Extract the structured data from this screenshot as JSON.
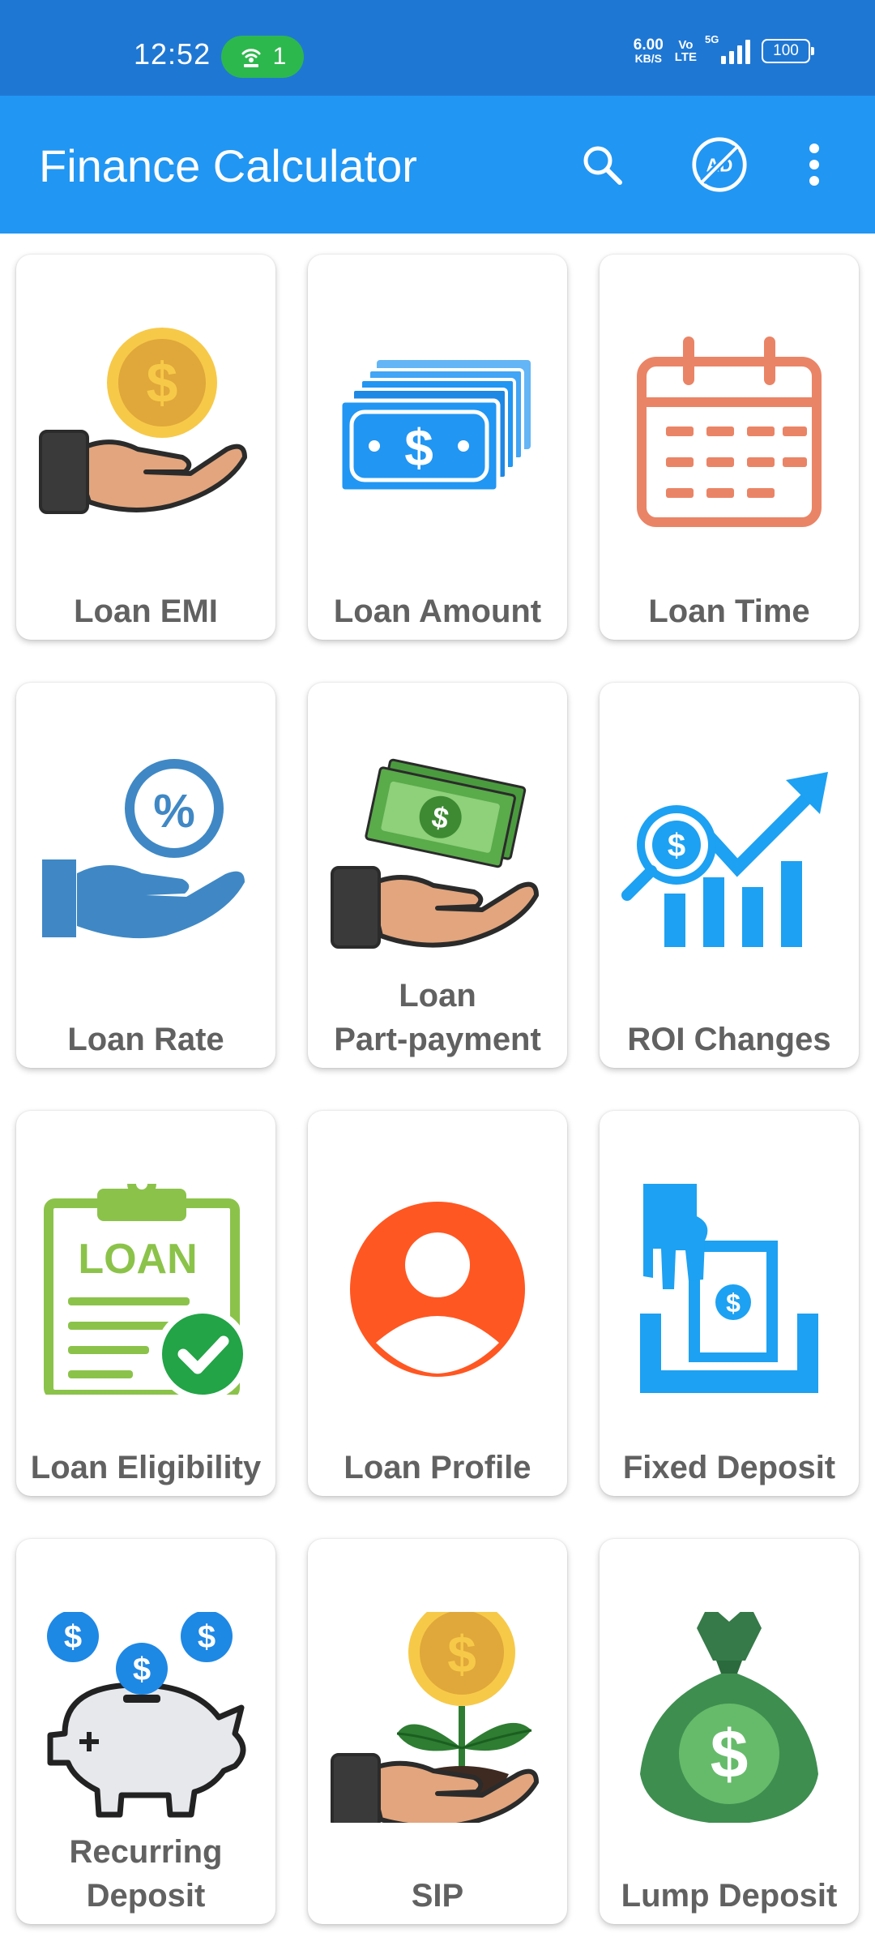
{
  "status_bar": {
    "time": "12:52",
    "hotspot_count": "1",
    "net_speed_value": "6.00",
    "net_speed_unit": "KB/S",
    "volte_top": "Vo",
    "volte_bottom": "LTE",
    "network_type": "5G",
    "battery": "100"
  },
  "app_bar": {
    "title": "Finance Calculator",
    "icons": [
      "search-icon",
      "ad-off-icon",
      "more-vert-icon"
    ]
  },
  "tiles": [
    {
      "label": "Loan EMI",
      "icon": "hand-coin-icon"
    },
    {
      "label": "Loan Amount",
      "icon": "cash-stack-icon"
    },
    {
      "label": "Loan Time",
      "icon": "calendar-icon"
    },
    {
      "label": "Loan Rate",
      "icon": "hand-percent-icon"
    },
    {
      "label": "Loan\nPart-payment",
      "icon": "hand-cash-icon"
    },
    {
      "label": "ROI Changes",
      "icon": "growth-chart-icon"
    },
    {
      "label": "Loan Eligibility",
      "icon": "loan-clipboard-icon"
    },
    {
      "label": "Loan Profile",
      "icon": "user-avatar-icon"
    },
    {
      "label": "Fixed Deposit",
      "icon": "cash-deposit-icon"
    },
    {
      "label": "Recurring\nDeposit",
      "icon": "piggy-bank-icon"
    },
    {
      "label": "SIP",
      "icon": "money-plant-icon"
    },
    {
      "label": "Lump Deposit",
      "icon": "money-bag-icon"
    }
  ],
  "colors": {
    "status_bar": "#1f77d4",
    "app_bar": "#2196f3",
    "label_text": "#616161"
  }
}
